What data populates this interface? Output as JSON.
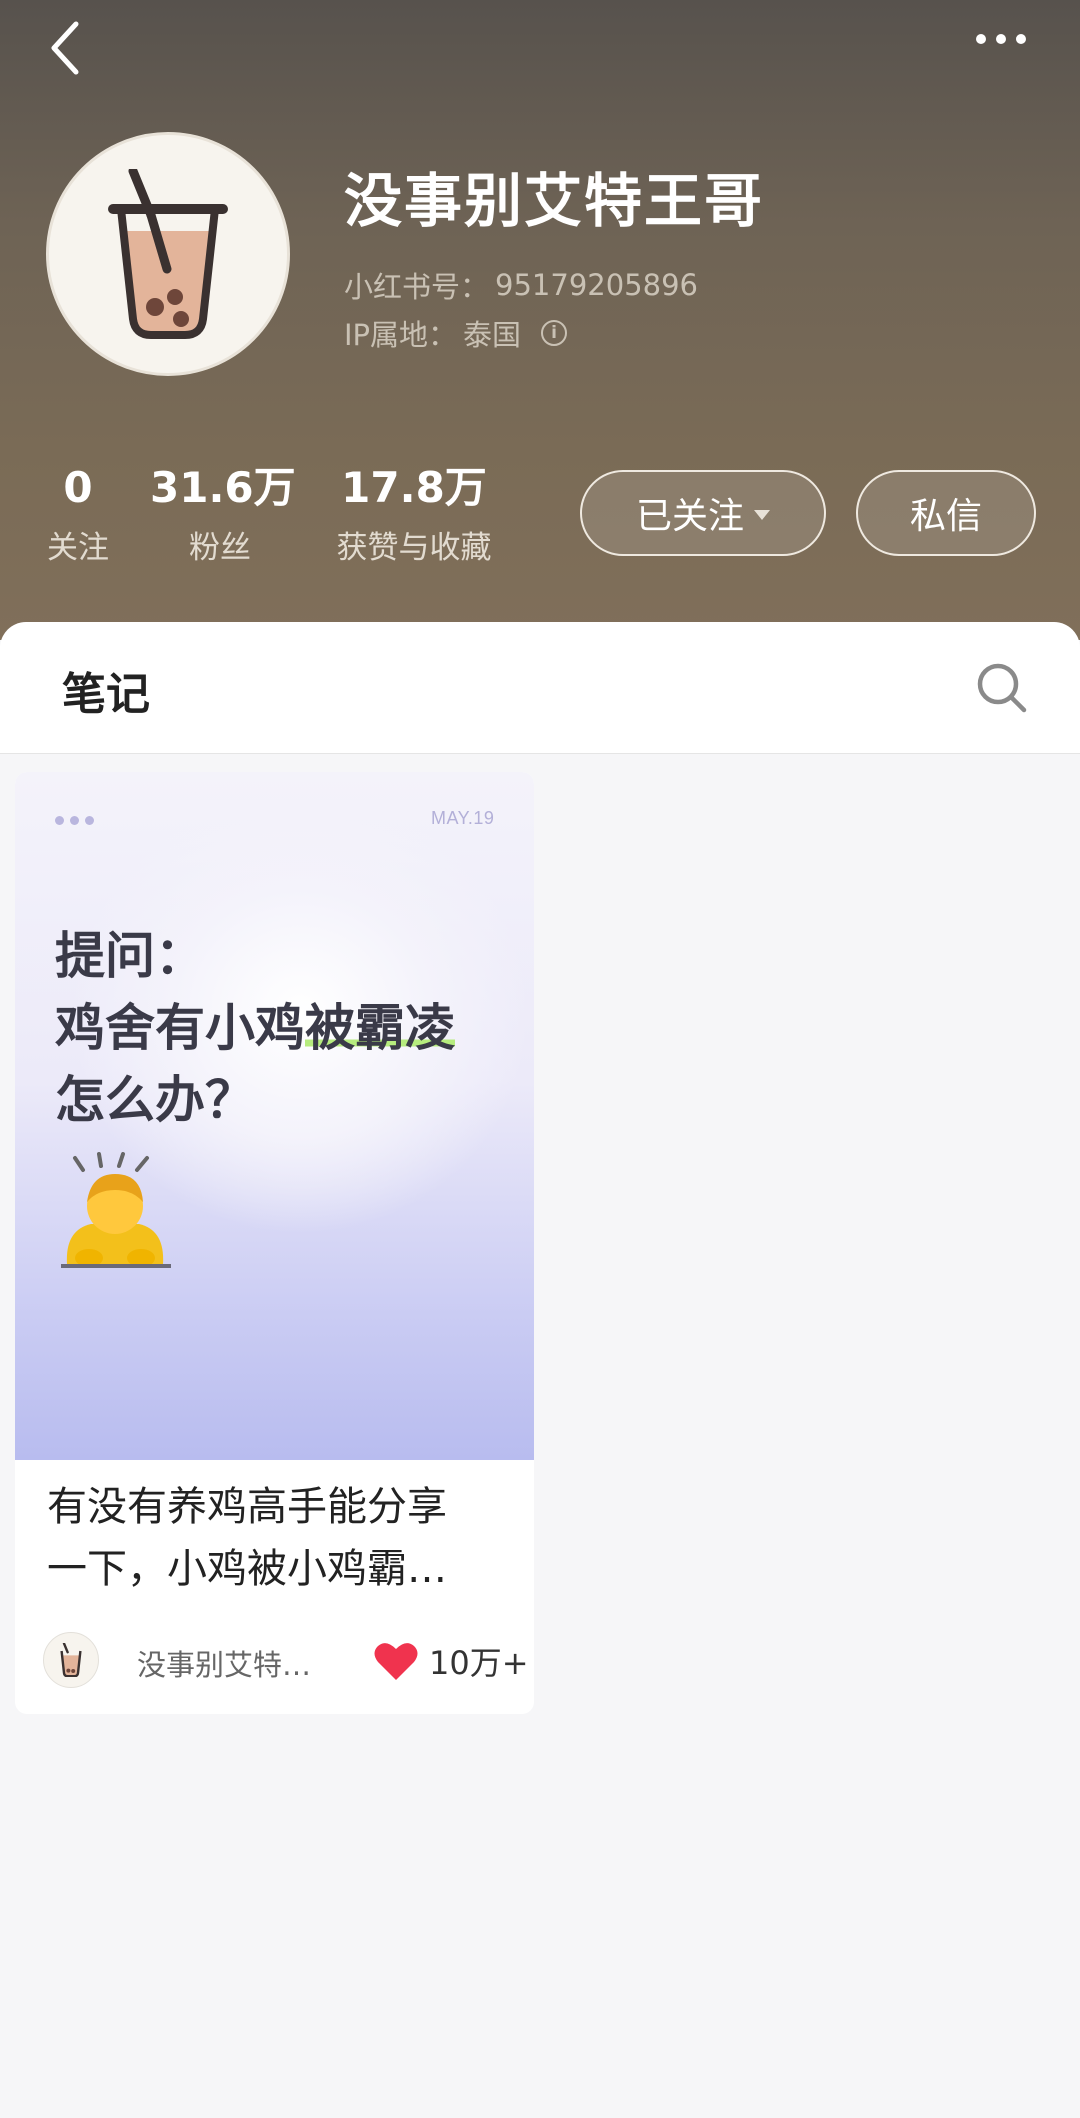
{
  "profile": {
    "nickname": "没事别艾特王哥",
    "red_id_label": "小红书号：",
    "red_id": "95179205896",
    "ip_label": "IP属地：",
    "ip_location": "泰国"
  },
  "stats": [
    {
      "value": "0",
      "label": "关注"
    },
    {
      "value": "31.6万",
      "label": "粉丝"
    },
    {
      "value": "17.8万",
      "label": "获赞与收藏"
    }
  ],
  "actions": {
    "follow_label": "已关注",
    "message_label": "私信"
  },
  "tabs": {
    "notes_label": "笔记"
  },
  "note": {
    "cover": {
      "date": "MAY.19",
      "title_lines": [
        "提问：",
        "鸡舍有小鸡",
        "被霸凌",
        "怎么办？"
      ]
    },
    "title_line1": "有没有养鸡高手能分享",
    "title_line2": "一下，小鸡被小鸡霸…",
    "author": "没事别艾特…",
    "likes": "10万+"
  },
  "colors": {
    "header_bg": "#6e6355",
    "like_heart": "#f0334e",
    "highlight": "#b6ec7e"
  },
  "icons": [
    "chevron-left-icon",
    "more-dots-icon",
    "milk-tea-icon",
    "info-icon",
    "caret-down-icon",
    "search-icon",
    "person-bowing-icon",
    "heart-icon"
  ]
}
